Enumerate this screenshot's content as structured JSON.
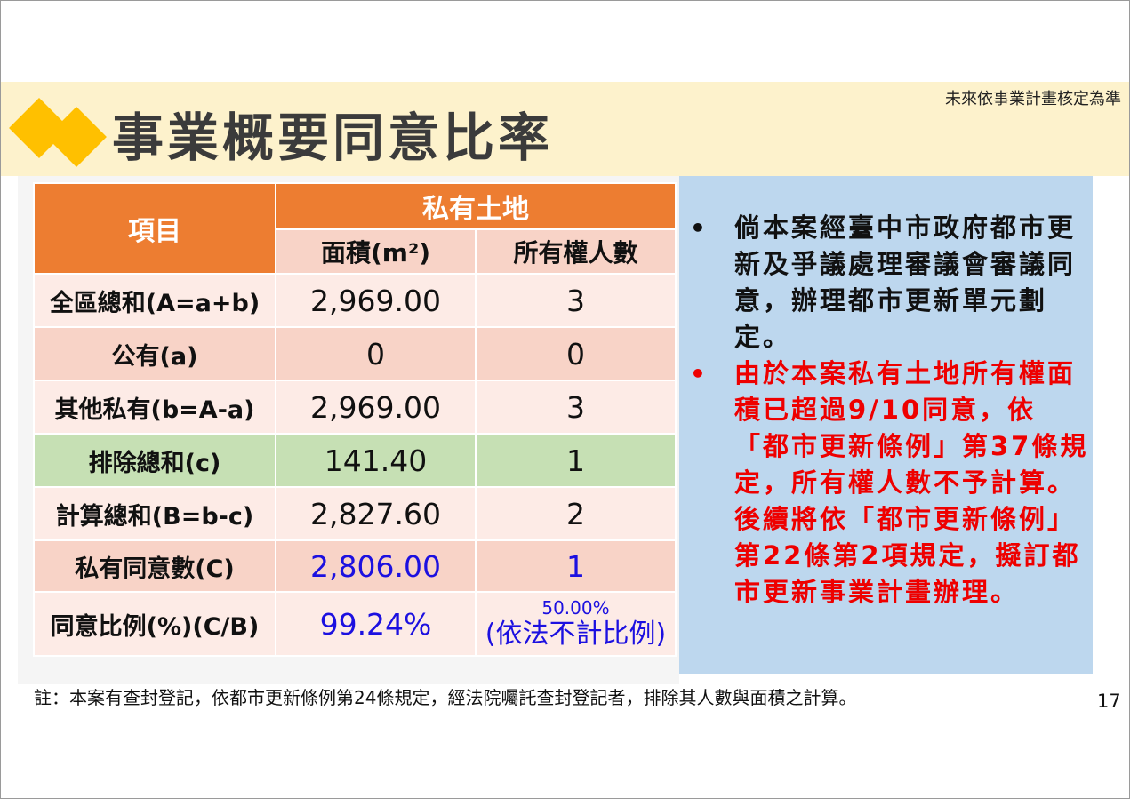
{
  "header": {
    "title": "事業概要同意比率",
    "top_note": "未來依事業計畫核定為準"
  },
  "table": {
    "item_header": "項目",
    "group_header": "私有土地",
    "col_area": "面積(m²)",
    "col_owners": "所有權人數",
    "rows": [
      {
        "label": "全區總和(A=a+b)",
        "area": "2,969.00",
        "owners": "3"
      },
      {
        "label": "公有(a)",
        "area": "0",
        "owners": "0"
      },
      {
        "label": "其他私有(b=A-a)",
        "area": "2,969.00",
        "owners": "3"
      },
      {
        "label": "排除總和(c)",
        "area": "141.40",
        "owners": "1"
      },
      {
        "label": "計算總和(B=b-c)",
        "area": "2,827.60",
        "owners": "2"
      },
      {
        "label": "私有同意數(C)",
        "area": "2,806.00",
        "owners": "1"
      },
      {
        "label": "同意比例(%)(C/B)",
        "area": "99.24%",
        "owners": "50.00%",
        "owners_note": "(依法不計比例)"
      }
    ]
  },
  "info": {
    "bullet_symbol": "•",
    "bullet1": "倘本案經臺中市政府都市更新及爭議處理審議會審議同意，辦理都市更新單元劃定。",
    "bullet2": "由於本案私有土地所有權面積已超過9/10同意，依「都市更新條例」第37條規定，所有權人數不予計算。後續將依「都市更新條例」第22條第2項規定，擬訂都市更新事業計畫辦理。"
  },
  "footnote": "註：本案有查封登記，依都市更新條例第24條規定，經法院囑託查封登記者，排除其人數與面積之計算。",
  "page_number": "17",
  "colors": {
    "accent_orange": "#ed7d31",
    "diamond_yellow": "#ffc000",
    "title_band": "#fdf2cc",
    "info_box": "#bdd7ee",
    "highlight_red": "#ee0000",
    "value_blue": "#1c10e0",
    "excluded_green": "#c6e0b4"
  }
}
